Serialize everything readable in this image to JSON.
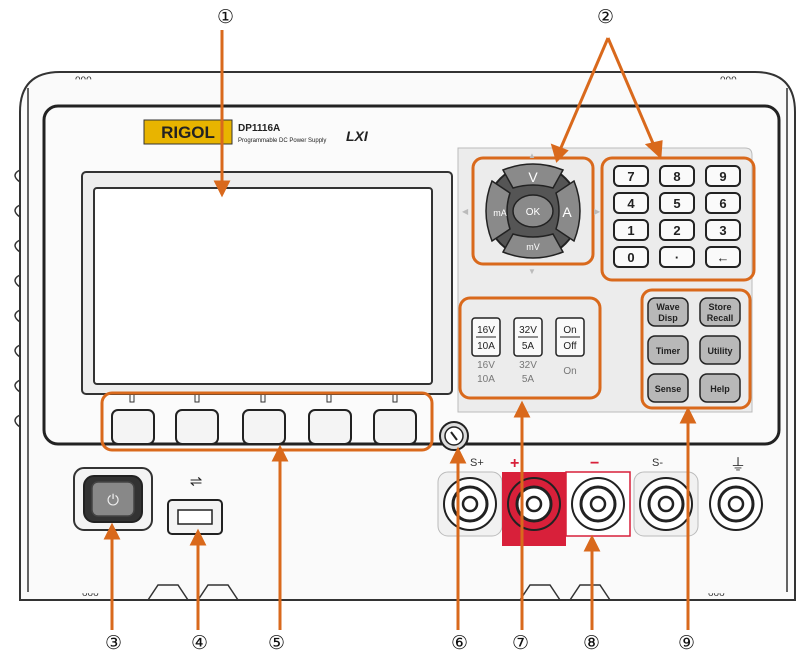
{
  "callouts": {
    "c1": "①",
    "c2": "②",
    "c3": "③",
    "c4": "④",
    "c5": "⑤",
    "c6": "⑥",
    "c7": "⑦",
    "c8": "⑧",
    "c9": "⑨"
  },
  "brand": {
    "logo": "RIGOL",
    "model": "DP1116A",
    "subtitle": "Programmable DC Power Supply",
    "lxi": "LXI"
  },
  "arrow_keys": {
    "up": "V",
    "left": "mA",
    "center": "OK",
    "right": "A",
    "down": "mV"
  },
  "numpad": [
    "7",
    "8",
    "9",
    "4",
    "5",
    "6",
    "1",
    "2",
    "3",
    "0",
    "·",
    "←"
  ],
  "range_keys": [
    {
      "top": "16V",
      "bottom": "10A"
    },
    {
      "top": "32V",
      "bottom": "5A"
    },
    {
      "top": "On",
      "bottom": "Off"
    }
  ],
  "range_labels": [
    {
      "top": "16V",
      "bottom": "10A"
    },
    {
      "top": "32V",
      "bottom": "5A"
    },
    {
      "top": "On",
      "bottom": ""
    }
  ],
  "function_keys": [
    {
      "line1": "Wave",
      "line2": "Disp"
    },
    {
      "line1": "Store",
      "line2": "Recall"
    },
    {
      "line1": "Timer",
      "line2": ""
    },
    {
      "line1": "Utility",
      "line2": ""
    },
    {
      "line1": "Sense",
      "line2": ""
    },
    {
      "line1": "Help",
      "line2": ""
    }
  ],
  "terminals": {
    "sense_plus": "S+",
    "plus": "+",
    "minus": "−",
    "sense_minus": "S-"
  },
  "colors": {
    "callout_orange": "#d9691c",
    "terminal_red": "#d8203a",
    "logo_yellow": "#e8b400"
  }
}
